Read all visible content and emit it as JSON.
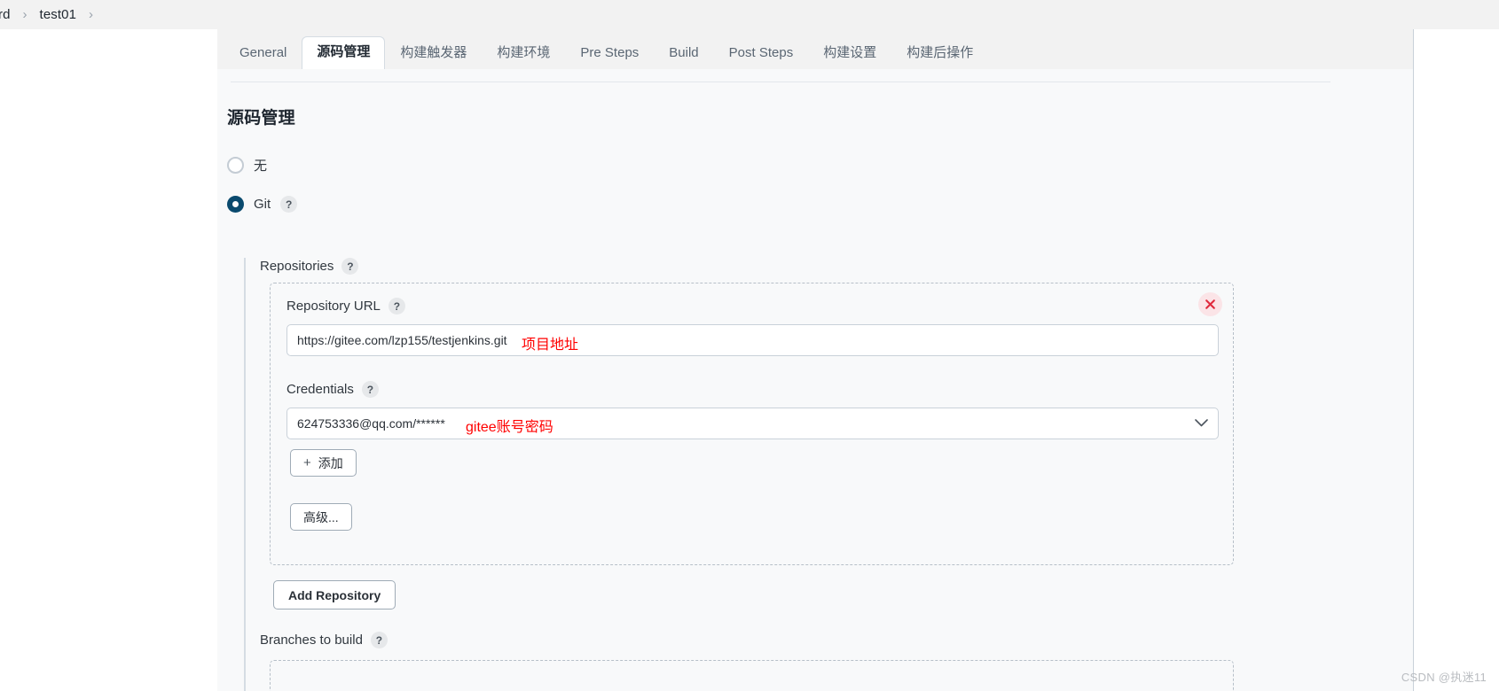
{
  "breadcrumb": {
    "items": [
      "rd",
      "test01"
    ],
    "separator": "›"
  },
  "tabs": [
    {
      "label": "General",
      "active": false
    },
    {
      "label": "源码管理",
      "active": true
    },
    {
      "label": "构建触发器",
      "active": false
    },
    {
      "label": "构建环境",
      "active": false
    },
    {
      "label": "Pre Steps",
      "active": false
    },
    {
      "label": "Build",
      "active": false
    },
    {
      "label": "Post Steps",
      "active": false
    },
    {
      "label": "构建设置",
      "active": false
    },
    {
      "label": "构建后操作",
      "active": false
    }
  ],
  "section": {
    "title": "源码管理",
    "scm_options": [
      {
        "label": "无",
        "checked": false,
        "has_help": false
      },
      {
        "label": "Git",
        "checked": true,
        "has_help": true
      }
    ]
  },
  "git": {
    "repositories_label": "Repositories",
    "repository": {
      "url_label": "Repository URL",
      "url_value": "https://gitee.com/lzp155/testjenkins.git",
      "url_annotation": "项目地址",
      "credentials_label": "Credentials",
      "credentials_value": "624753336@qq.com/******",
      "credentials_annotation": "gitee账号密码",
      "add_credentials_label": "添加",
      "add_credentials_icon": "+",
      "advanced_label": "高级...",
      "delete_icon": "close-icon"
    },
    "add_repository_label": "Add Repository",
    "branches_label": "Branches to build"
  },
  "help_badge": "?",
  "watermark": "CSDN @执迷11",
  "colors": {
    "accent": "#0a4a6e",
    "annotation": "#ff0000",
    "delete": "#e02b3e",
    "page_bg": "#f8f9fa",
    "chrome_bg": "#f2f2f2"
  }
}
